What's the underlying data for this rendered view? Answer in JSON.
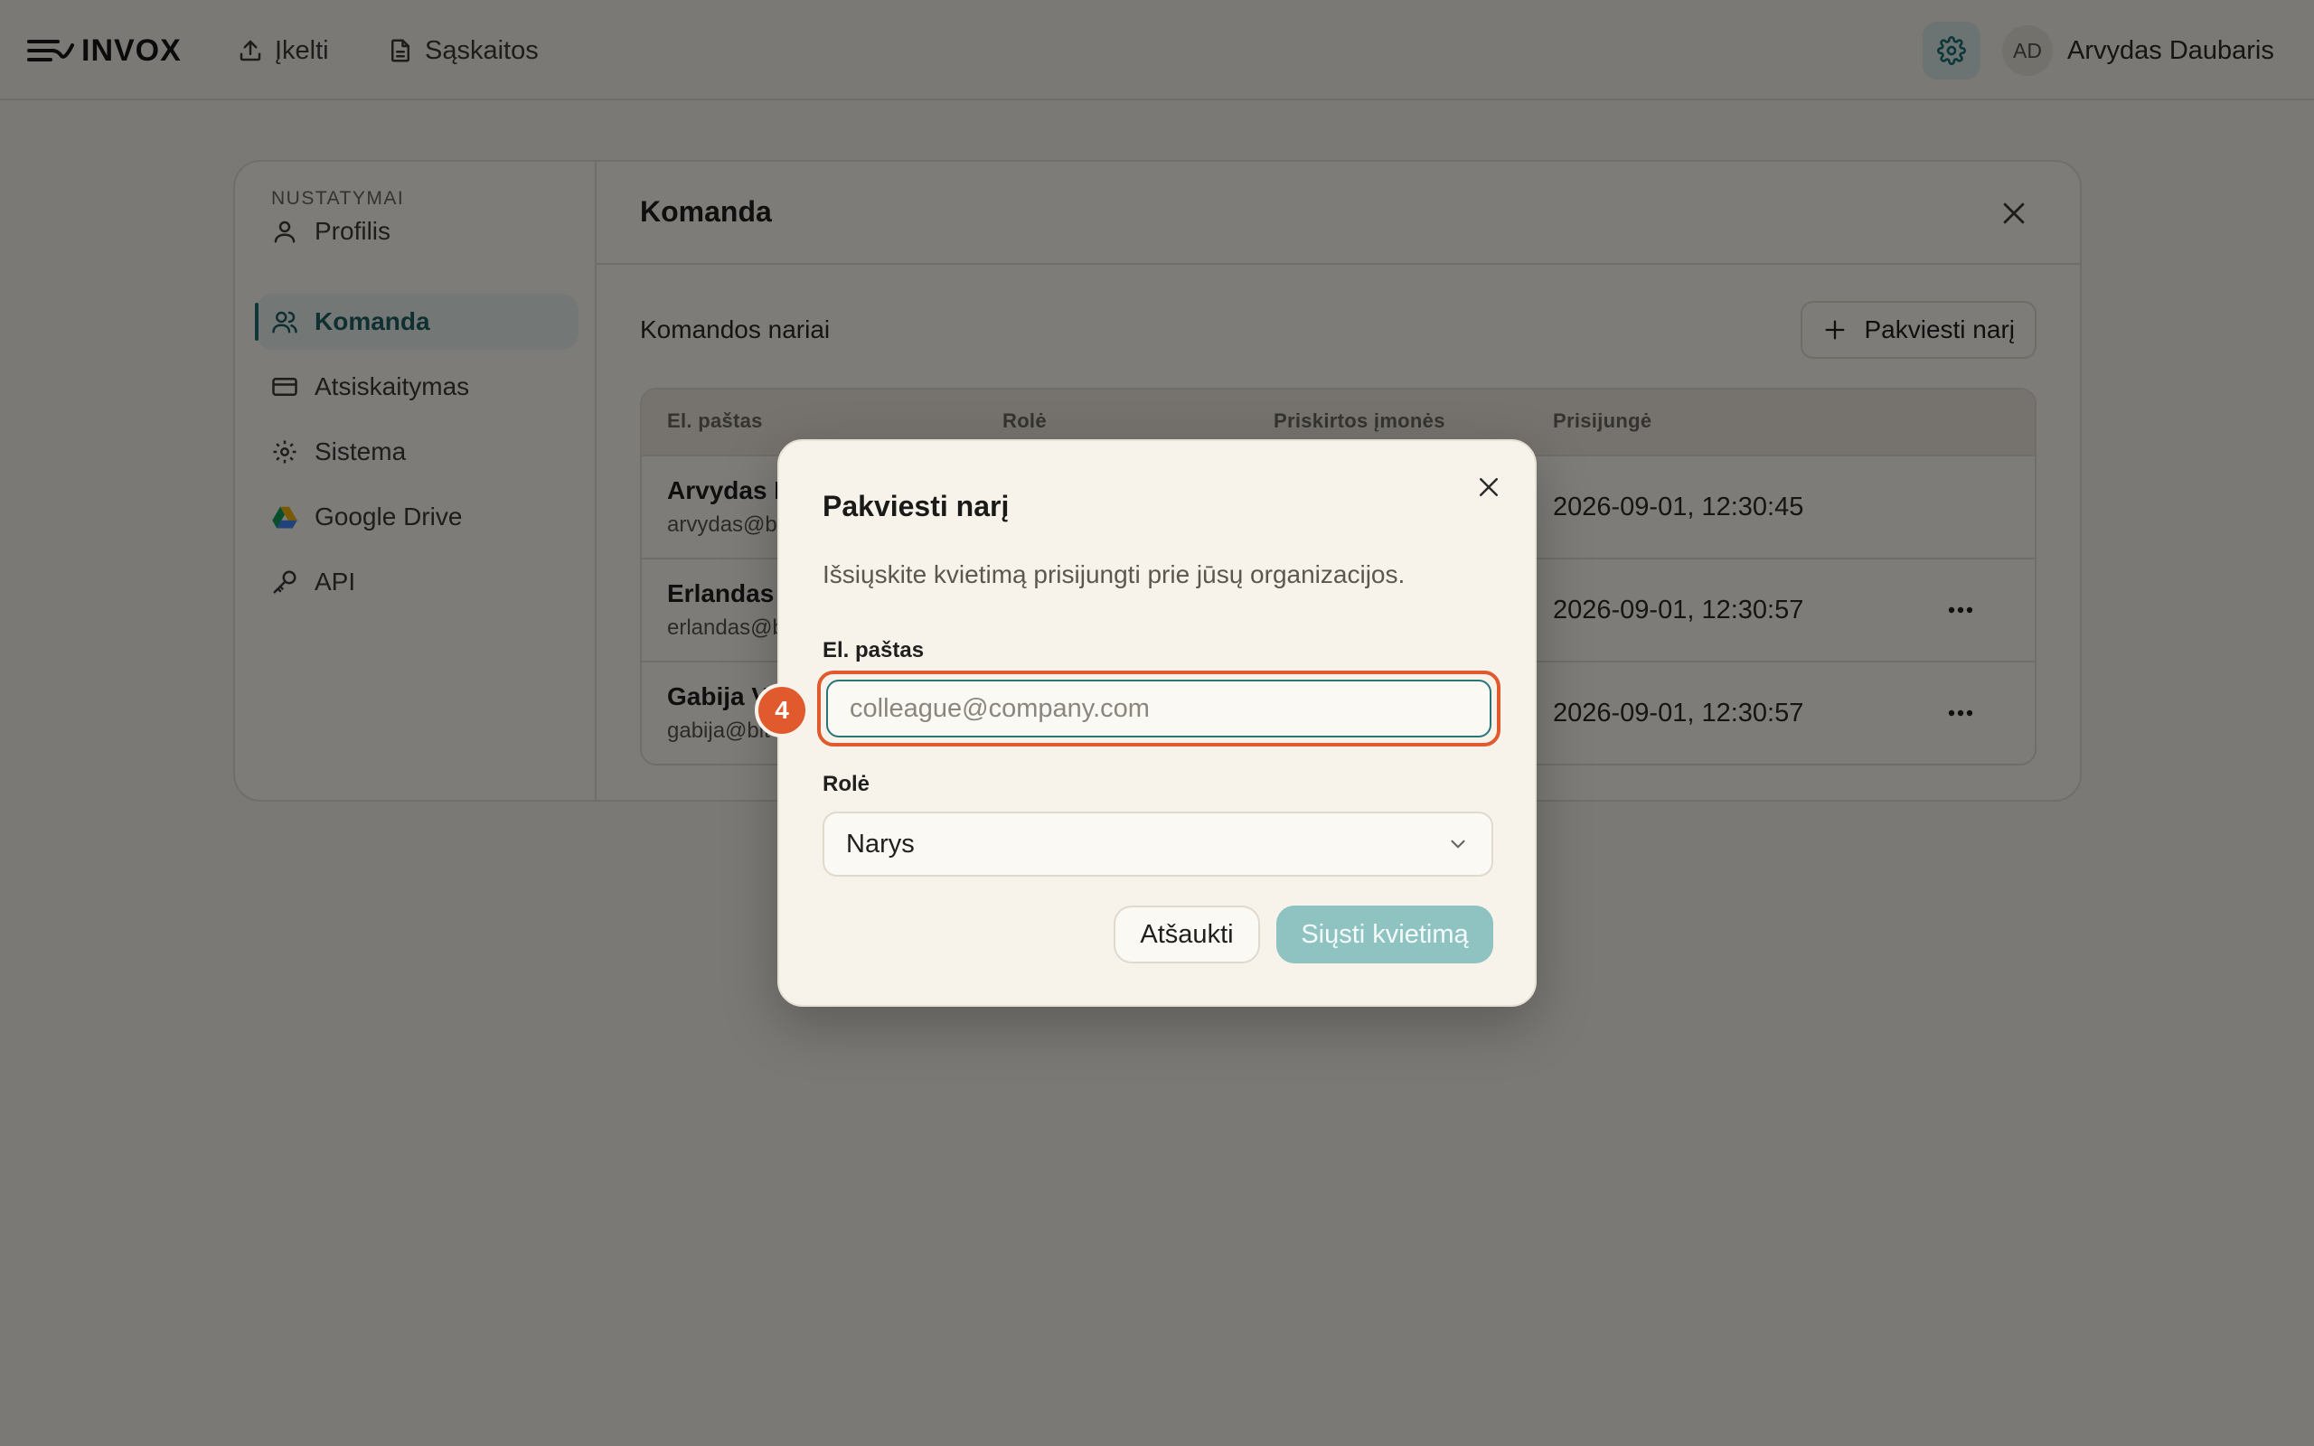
{
  "topbar": {
    "logo_text": "INVOX",
    "nav": {
      "upload_label": "Įkelti",
      "invoices_label": "Sąskaitos"
    },
    "user": {
      "initials": "AD",
      "name": "Arvydas Daubaris"
    }
  },
  "settings": {
    "heading": "NUSTATYMAI",
    "items": [
      {
        "label": "Profilis"
      },
      {
        "label": "Komanda"
      },
      {
        "label": "Atsiskaitymas"
      },
      {
        "label": "Sistema"
      },
      {
        "label": "Google Drive"
      },
      {
        "label": "API"
      }
    ]
  },
  "team": {
    "title": "Komanda",
    "members_title": "Komandos nariai",
    "invite_button": "Pakviesti narį",
    "columns": [
      "El. paštas",
      "Rolė",
      "Priskirtos įmonės",
      "Prisijungė"
    ],
    "rows": [
      {
        "name": "Arvydas D",
        "email": "arvydas@b",
        "last_login": "2026-09-01, 12:30:45"
      },
      {
        "name": "Erlandas T",
        "email": "erlandas@b",
        "last_login": "2026-09-01, 12:30:57"
      },
      {
        "name": "Gabija V",
        "email": "gabija@bit",
        "last_login": "2026-09-01, 12:30:57"
      }
    ]
  },
  "dialog": {
    "title": "Pakviesti narį",
    "description": "Išsiųskite kvietimą prisijungti prie jūsų organizacijos.",
    "email_label": "El. paštas",
    "email_placeholder": "colleague@company.com",
    "role_label": "Rolė",
    "role_value": "Narys",
    "cancel_label": "Atšaukti",
    "send_label": "Siųsti kvietimą"
  },
  "annotation": {
    "step": "4",
    "color": "#e05a2e"
  },
  "colors": {
    "accent": "#1f6f72",
    "send_button": "#8fc3c2"
  }
}
